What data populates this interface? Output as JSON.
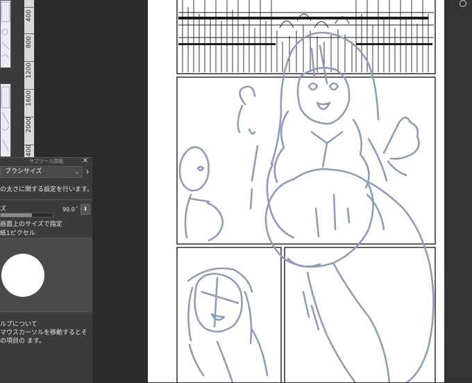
{
  "ruler": {
    "labels": [
      "400",
      "800",
      "1200",
      "1600",
      "2000",
      "400"
    ]
  },
  "subtool_panel": {
    "title": "サブツール詳細",
    "close_glyph": "✕",
    "preset_label": "ブラシサイズ",
    "preset_chevron": "⌄",
    "next_glyph": "›",
    "description": "の太さに関する設定を行います。",
    "size_label": "ズ",
    "size_value": "90.0",
    "size_fraction": 0.6,
    "stepper_glyph": "⌃⌄",
    "lock_glyph": "⬇",
    "option_screen": "画面上のサイズで指定",
    "option_pixel": "紙1ピクセル",
    "help_title": "ルプについて",
    "help_text": "マウスカーソルを移動するとその項目の ます。"
  },
  "colors": {
    "sketch_stroke": "#8e9cbb",
    "ink": "#1a1a1a",
    "panel_bg": "#3b3b3b",
    "workspace_bg": "#2b2b2b"
  }
}
